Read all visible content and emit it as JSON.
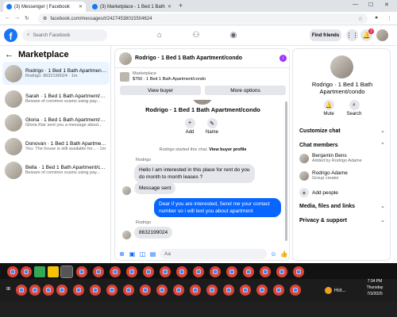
{
  "browser": {
    "tabs": [
      {
        "title": "(3) Messenger | Facebook",
        "active": true
      },
      {
        "title": "(3) Marketplace - 1 Bed 1 Bath",
        "active": false
      }
    ],
    "new_tab": "+",
    "url": "facebook.com/messages/t/24274538015504624",
    "win_min": "—",
    "win_max": "☐",
    "win_close": "✕"
  },
  "facebook": {
    "logo": "f",
    "search_placeholder": "Search Facebook",
    "find_friends": "Find friends",
    "notif_count": "3",
    "nav_icons": [
      "home-icon",
      "people-icon",
      "groups-icon"
    ]
  },
  "left": {
    "title": "Marketplace",
    "conversations": [
      {
        "name": "Rodrigo · 1 Bed 1 Bath Apartment/condo",
        "snippet": "Rodrigo: 8632199024 · 1m",
        "selected": true
      },
      {
        "name": "Sarah · 1 Bed 1 Bath Apartment/condo",
        "snippet": "Beware of common scams using pay...",
        "selected": false
      },
      {
        "name": "Gloria · 1 Bed 1 Bath Apartment/condo",
        "snippet": "Gloria Klar sent you a message about...",
        "selected": false
      },
      {
        "name": "Donovan · 1 Bed 1 Bath Apartment/condo",
        "snippet": "You: The house is still available for... · 1m",
        "selected": false
      },
      {
        "name": "Bella · 1 Bed 1 Bath Apartment/condo",
        "snippet": "Beware of common scams using pay...",
        "selected": false
      }
    ]
  },
  "chat": {
    "header_name": "Rodrigo · 1 Bed 1 Bath Apartment/condo",
    "header_badge": "i",
    "listing_label": "Marketplace",
    "listing_title": "$750 · 1 Bed 1 Bath Apartment/condo",
    "view_buyer": "View buyer",
    "more_options": "More options",
    "intro_name": "Rodrigo · 1 Bed 1 Bath Apartment/condo",
    "intro_add": "Add",
    "intro_name_btn": "Name",
    "system_prefix": "Rodrigo started this chat.",
    "system_link": "View buyer profile",
    "sender1": "Rodrigo",
    "msg1": "Hello I am interested in this place for rent do you do month to month leases ?",
    "msg2": "Message sent",
    "msg3": "Dear if you are interested, Send me your contact number so i will text you about apartment",
    "sender2": "Rodrigo",
    "msg4": "8632199024",
    "composer_placeholder": "Aa"
  },
  "right": {
    "name": "Rodrigo · 1 Bed 1 Bath Apartment/condo",
    "mute": "Mute",
    "search": "Search",
    "customize": "Customize chat",
    "members_title": "Chat members",
    "members": [
      {
        "name": "Benjamin Bens",
        "sub": "Added by Rodrigo Adame"
      },
      {
        "name": "Rodrigo Adame",
        "sub": "Group creator"
      }
    ],
    "add_people": "Add people",
    "media": "Media, files and links",
    "privacy": "Privacy & support"
  },
  "taskbar": {
    "weather": "Hot...",
    "time": "7:34 PM",
    "day": "Thursday",
    "date": "7/3/2025"
  }
}
